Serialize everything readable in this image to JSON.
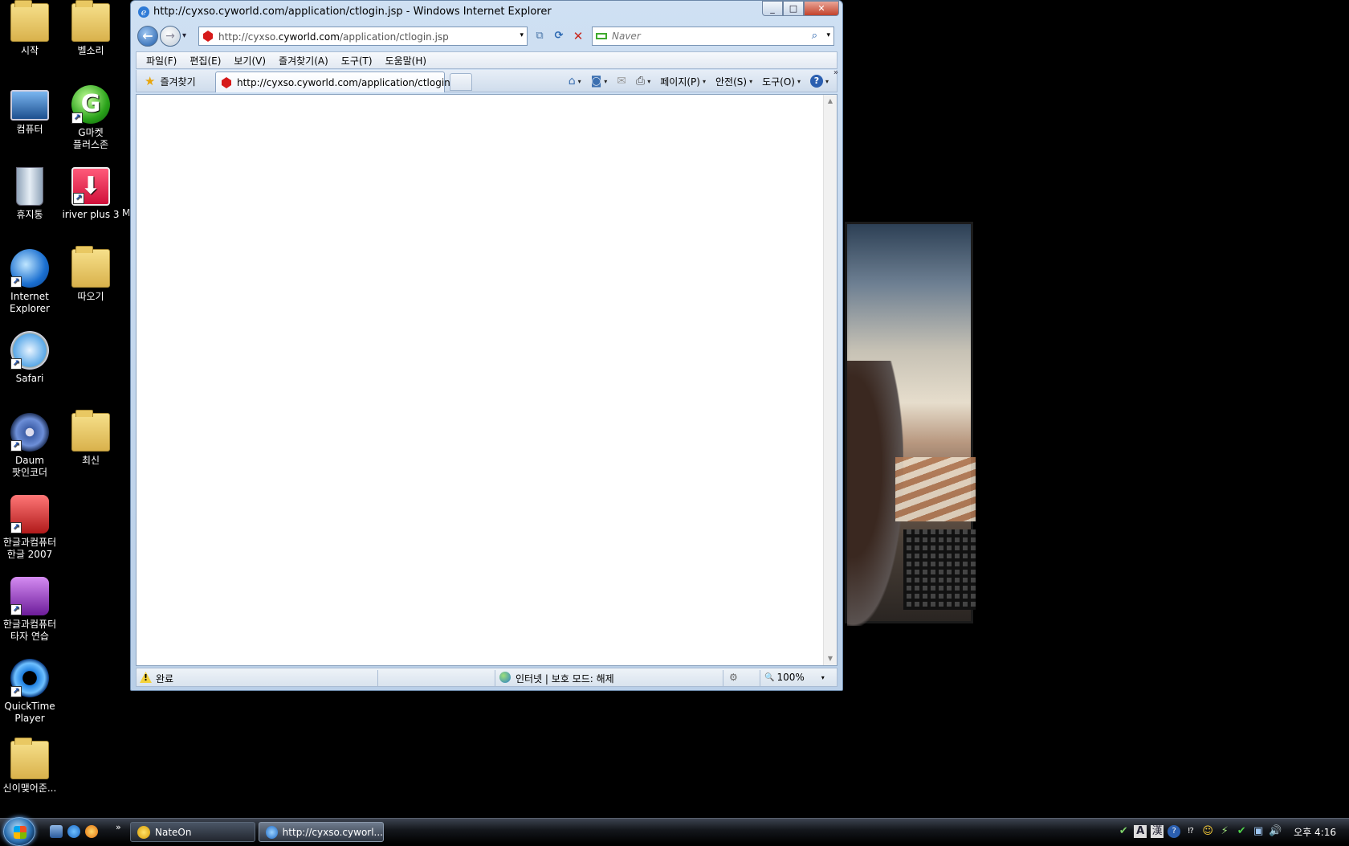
{
  "desktop": {
    "icons": [
      {
        "label": "시작"
      },
      {
        "label": "벨소리"
      },
      {
        "label": "컴퓨터"
      },
      {
        "label": "G마켓\n플러스존"
      },
      {
        "label": "휴지통"
      },
      {
        "label": "iriver plus 3"
      },
      {
        "label": "Internet\nExplorer"
      },
      {
        "label": "따오기"
      },
      {
        "label": "Safari"
      },
      {
        "label": "Daum\n팟인코더"
      },
      {
        "label": "최신"
      },
      {
        "label": "한글과컴퓨터\n한글 2007"
      },
      {
        "label": "한글과컴퓨터\n타자 연습"
      },
      {
        "label": "QuickTime\nPlayer"
      },
      {
        "label": "신이맺어준..."
      }
    ],
    "stray_letter": "M"
  },
  "window": {
    "title": "http://cyxso.cyworld.com/application/ctlogin.jsp - Windows Internet Explorer",
    "min": "_",
    "max": "□",
    "close": "✕"
  },
  "nav": {
    "back": "←",
    "forward": "→",
    "history": "▾",
    "url_prefix": "http://cyxso.",
    "url_domain": "cyworld.com",
    "url_suffix": "/application/ctlogin.jsp",
    "url_drop": "▾",
    "compat": "⧉",
    "refresh": "⟳",
    "stop": "✕",
    "search_placeholder": "Naver",
    "search_icon": "⌕",
    "search_drop": "▾"
  },
  "menu": [
    "파일(F)",
    "편집(E)",
    "보기(V)",
    "즐겨찾기(A)",
    "도구(T)",
    "도움말(H)"
  ],
  "tabs": {
    "favorites": "즐겨찾기",
    "star": "★",
    "active": "http://cyxso.cyworld.com/application/ctlogin.jsp"
  },
  "commands": {
    "home": "⌂",
    "feeds": "◙",
    "mail": "✉",
    "print": "⎙",
    "page": "페이지(P)",
    "safety": "안전(S)",
    "tools": "도구(O)",
    "help": "?",
    "caret": "▾",
    "chevron": "»"
  },
  "scroll": {
    "up": "▲",
    "down": "▼"
  },
  "status": {
    "warn": "!",
    "text": "완료",
    "zone": "인터넷 | 보호 모드: 해제",
    "protected_icon": "⚙",
    "zoom_icon": "🔍",
    "zoom": "100%",
    "caret": "▾"
  },
  "taskbar": {
    "more": "»",
    "tasks": [
      "NateOn",
      "http://cyxso.cyworl..."
    ],
    "tray": [
      "✔",
      "A",
      "漢",
      "?",
      "⁉",
      "☺",
      "⚡",
      "✔",
      "▣",
      "🔊"
    ],
    "clock": "오후 4:16"
  }
}
